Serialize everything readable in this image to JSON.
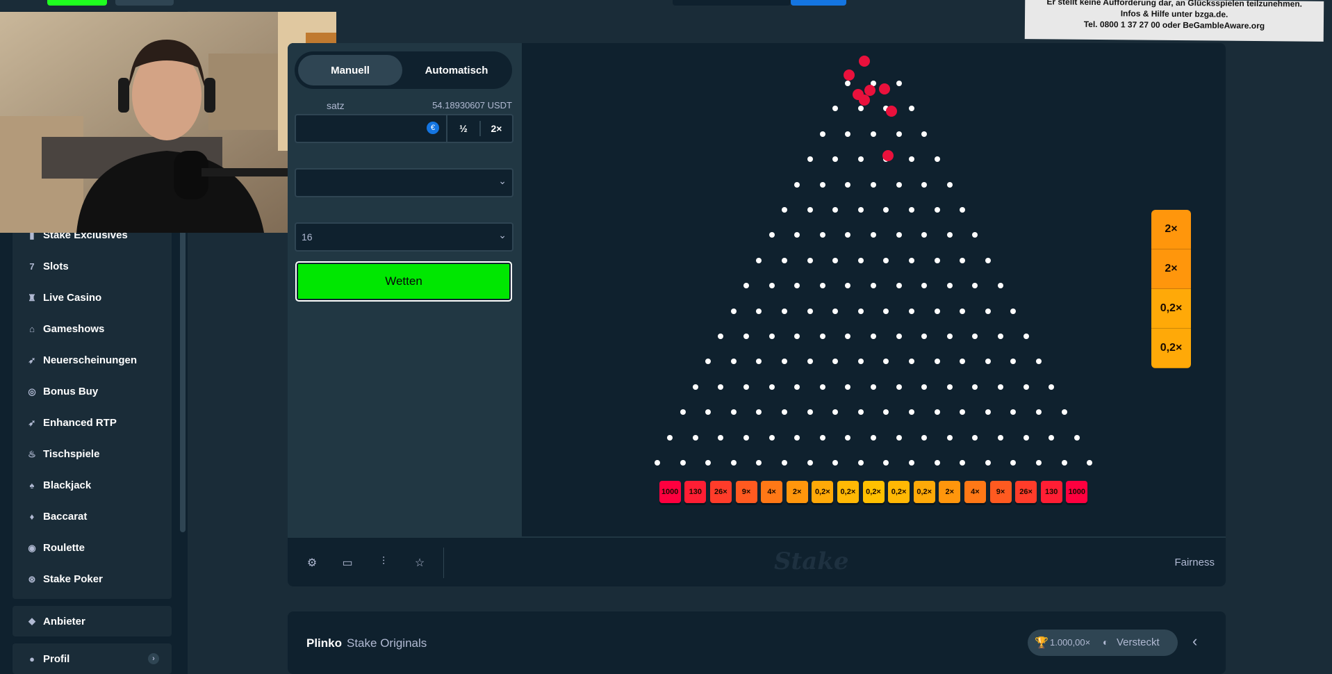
{
  "notice": {
    "line1": "Er stellt keine Aufforderung dar, an Glücksspielen teilzunehmen.",
    "line2": "Infos & Hilfe unter bzga.de.",
    "line3": "Tel. 0800 1 37 27 00 oder BeGambleAware.org"
  },
  "sidebar": {
    "items": [
      {
        "label": "Stake Exclusives",
        "icon": "bookmark-icon"
      },
      {
        "label": "Slots",
        "icon": "slots-icon"
      },
      {
        "label": "Live Casino",
        "icon": "live-casino-icon"
      },
      {
        "label": "Gameshows",
        "icon": "gift-icon"
      },
      {
        "label": "Neuerscheinungen",
        "icon": "rocket-icon"
      },
      {
        "label": "Bonus Buy",
        "icon": "bonus-buy-icon"
      },
      {
        "label": "Enhanced RTP",
        "icon": "rocket-icon"
      },
      {
        "label": "Tischspiele",
        "icon": "flame-icon"
      },
      {
        "label": "Blackjack",
        "icon": "spade-icon"
      },
      {
        "label": "Baccarat",
        "icon": "baccarat-icon"
      },
      {
        "label": "Roulette",
        "icon": "roulette-icon"
      },
      {
        "label": "Stake Poker",
        "icon": "poker-chip-icon"
      }
    ],
    "provider_label": "Anbieter",
    "profile_label": "Profil"
  },
  "game": {
    "tab_manual": "Manuell",
    "tab_auto": "Automatisch",
    "bet_label": "satz",
    "balance": "54.18930607 USDT",
    "half_label": "½",
    "double_label": "2×",
    "rows_value": "16",
    "bet_button": "Wetten",
    "multipliers": [
      "1000",
      "130",
      "26×",
      "9×",
      "4×",
      "2×",
      "0,2×",
      "0,2×",
      "0,2×",
      "0,2×",
      "0,2×",
      "2×",
      "4×",
      "9×",
      "26×",
      "130",
      "1000"
    ],
    "multiplier_colors": [
      "#ff003f",
      "#ff1e34",
      "#ff3c2a",
      "#ff5a20",
      "#ff7816",
      "#ff960c",
      "#ffa908",
      "#ffb804",
      "#ffc000",
      "#ffb804",
      "#ffa908",
      "#ff960c",
      "#ff7816",
      "#ff5a20",
      "#ff3c2a",
      "#ff1e34",
      "#ff003f"
    ],
    "history": [
      "2×",
      "2×",
      "0,2×",
      "0,2×"
    ],
    "history_colors": [
      "#ff960c",
      "#ff960c",
      "#ffa908",
      "#ffa908"
    ]
  },
  "footer": {
    "logo": "Stake",
    "fairness": "Fairness",
    "icons": [
      "settings-icon",
      "theatre-mode-icon",
      "stats-icon",
      "favourite-icon"
    ]
  },
  "info": {
    "game_name": "Plinko",
    "provider": "Stake Originals",
    "max_win": "1.000,00×",
    "hidden_label": "Versteckt"
  }
}
